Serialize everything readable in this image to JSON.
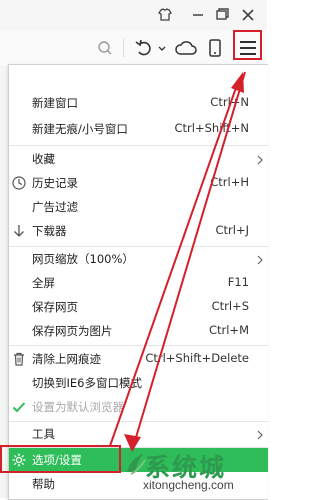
{
  "menu": {
    "items": [
      {
        "label": "新建窗口",
        "shortcut": "Ctrl+N"
      },
      {
        "label": "新建无痕/小号窗口",
        "shortcut": "Ctrl+Shift+N"
      },
      {
        "label": "收藏",
        "shortcut": ""
      },
      {
        "label": "历史记录",
        "shortcut": "Ctrl+H"
      },
      {
        "label": "广告过滤",
        "shortcut": ""
      },
      {
        "label": "下载器",
        "shortcut": "Ctrl+J"
      },
      {
        "label": "网页缩放（100%）",
        "shortcut": ""
      },
      {
        "label": "全屏",
        "shortcut": "F11"
      },
      {
        "label": "保存网页",
        "shortcut": "Ctrl+S"
      },
      {
        "label": "保存网页为图片",
        "shortcut": "Ctrl+M"
      },
      {
        "label": "清除上网痕迹",
        "shortcut": "Ctrl+Shift+Delete"
      },
      {
        "label": "切换到IE6多窗口模式",
        "shortcut": ""
      },
      {
        "label": "设置为默认浏览器",
        "shortcut": ""
      },
      {
        "label": "工具",
        "shortcut": ""
      },
      {
        "label": "选项/设置",
        "shortcut": ""
      },
      {
        "label": "帮助",
        "shortcut": ""
      }
    ]
  },
  "watermark": {
    "brand": "系统城",
    "url": "xitongcheng.com"
  },
  "colors": {
    "highlight_red": "#d4202a",
    "active_green": "#2ebd59"
  }
}
